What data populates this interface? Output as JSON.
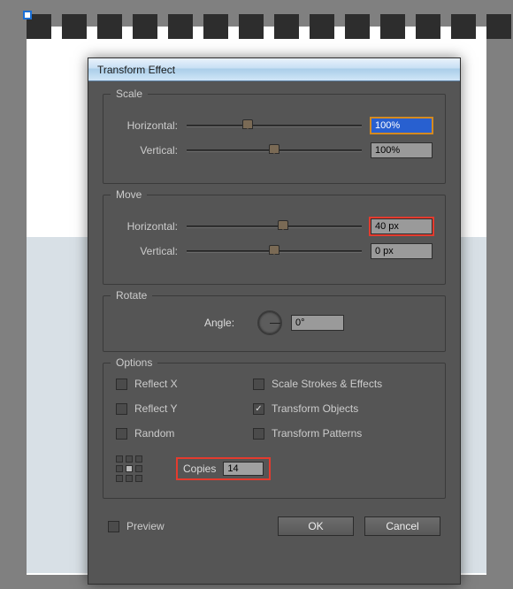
{
  "dialog": {
    "title": "Transform Effect",
    "scale": {
      "legend": "Scale",
      "horizontal_label": "Horizontal:",
      "horizontal_value": "100%",
      "vertical_label": "Vertical:",
      "vertical_value": "100%"
    },
    "move": {
      "legend": "Move",
      "horizontal_label": "Horizontal:",
      "horizontal_value": "40 px",
      "vertical_label": "Vertical:",
      "vertical_value": "0 px"
    },
    "rotate": {
      "legend": "Rotate",
      "angle_label": "Angle:",
      "angle_value": "0°"
    },
    "options": {
      "legend": "Options",
      "reflect_x": "Reflect X",
      "reflect_y": "Reflect Y",
      "random": "Random",
      "scale_strokes": "Scale Strokes & Effects",
      "transform_objects": "Transform Objects",
      "transform_patterns": "Transform Patterns",
      "copies_label": "Copies",
      "copies_value": "14",
      "checked": {
        "transform_objects": true
      }
    },
    "preview_label": "Preview",
    "ok_label": "OK",
    "cancel_label": "Cancel"
  }
}
